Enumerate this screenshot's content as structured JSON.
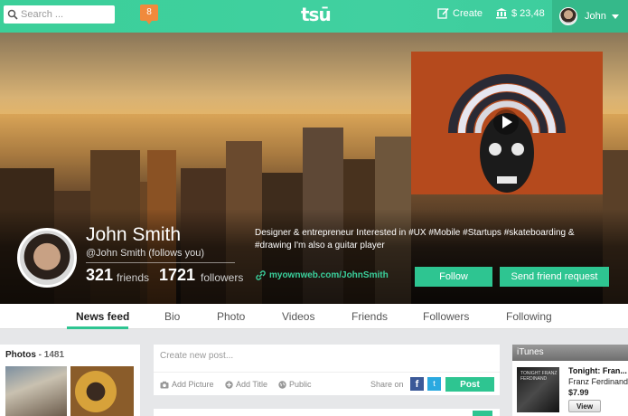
{
  "topbar": {
    "search_placeholder": "Search ...",
    "notification_count": "8",
    "logo": "tsū",
    "create_label": "Create",
    "balance": "$ 23,48",
    "user_name": "John"
  },
  "profile": {
    "name": "John Smith",
    "handle": "@John Smith (follows you)",
    "friends_count": "321",
    "friends_label": "friends",
    "followers_count": "1721",
    "followers_label": "followers",
    "bio": "Designer & entrepreneur Interested in #UX #Mobile #Startups #skateboarding & #drawing I'm also a guitar player",
    "website": "myownweb.com/JohnSmith",
    "follow_label": "Follow",
    "friend_request_label": "Send friend request"
  },
  "tabs": [
    "News feed",
    "Bio",
    "Photo",
    "Videos",
    "Friends",
    "Followers",
    "Following"
  ],
  "photos": {
    "title": "Photos",
    "separator": " - ",
    "count": "1481"
  },
  "composer": {
    "placeholder": "Create new post...",
    "add_picture": "Add Picture",
    "add_title": "Add Title",
    "visibility": "Public",
    "share_on": "Share on",
    "facebook": "f",
    "twitter": "t",
    "post_label": "Post"
  },
  "itunes": {
    "header": "iTunes",
    "song": "Tonight: Fran...",
    "artist": "Franz Ferdinand",
    "price": "$7.99",
    "view_label": "View",
    "album_text": "TONIGHT FRANZ FERDINAND"
  },
  "colors": {
    "accent": "#2ec591",
    "notification": "#f08a3c",
    "facebook": "#3b5998",
    "twitter": "#2aa9e0"
  }
}
